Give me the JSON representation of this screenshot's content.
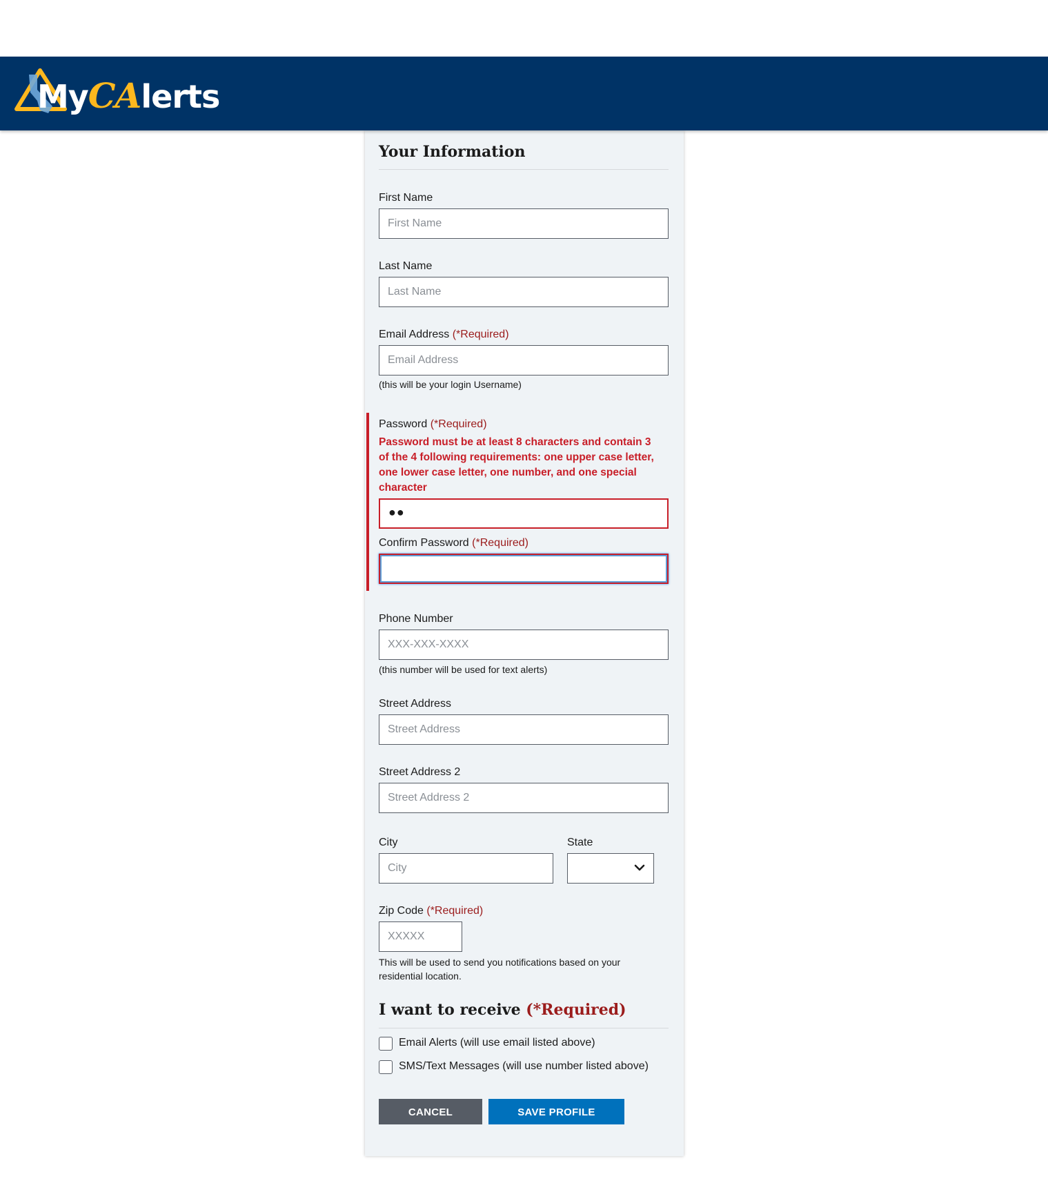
{
  "header": {
    "logo_text_my": "My",
    "logo_text_ca": "CA",
    "logo_text_lerts": "lerts"
  },
  "form": {
    "section_title": "Your Information",
    "first_name": {
      "label": "First Name",
      "placeholder": "First Name",
      "value": ""
    },
    "last_name": {
      "label": "Last Name",
      "placeholder": "Last Name",
      "value": ""
    },
    "email": {
      "label": "Email Address",
      "required": "(*Required)",
      "placeholder": "Email Address",
      "hint": "(this will be your login Username)"
    },
    "password": {
      "label": "Password",
      "required": "(*Required)",
      "error": "Password must be at least 8 characters and contain 3 of the 4 following requirements: one upper case letter, one lower case letter, one number, and one special character",
      "masked_value": "●●"
    },
    "confirm_password": {
      "label": "Confirm Password",
      "required": "(*Required)"
    },
    "phone": {
      "label": "Phone Number",
      "placeholder": "XXX-XXX-XXXX",
      "hint": "(this number will be used for text alerts)"
    },
    "street": {
      "label": "Street Address",
      "placeholder": "Street Address"
    },
    "street2": {
      "label": "Street Address 2",
      "placeholder": "Street Address 2"
    },
    "city": {
      "label": "City",
      "placeholder": "City"
    },
    "state": {
      "label": "State",
      "value": ""
    },
    "zip": {
      "label": "Zip Code",
      "required": "(*Required)",
      "placeholder": "XXXXX",
      "hint": "This will be used to send you notifications based on your residential location."
    },
    "receive_title": "I want to receive",
    "receive_required": "(*Required)",
    "email_alerts_label": "Email Alerts (will use email listed above)",
    "sms_label": "SMS/Text Messages (will use number listed above)",
    "cancel_label": "CANCEL",
    "save_label": "SAVE PROFILE"
  },
  "colors": {
    "header_bg": "#003366",
    "required": "#9b1c1c",
    "error": "#c81e28",
    "save_button": "#0071bc",
    "cancel_button": "#565c65"
  }
}
